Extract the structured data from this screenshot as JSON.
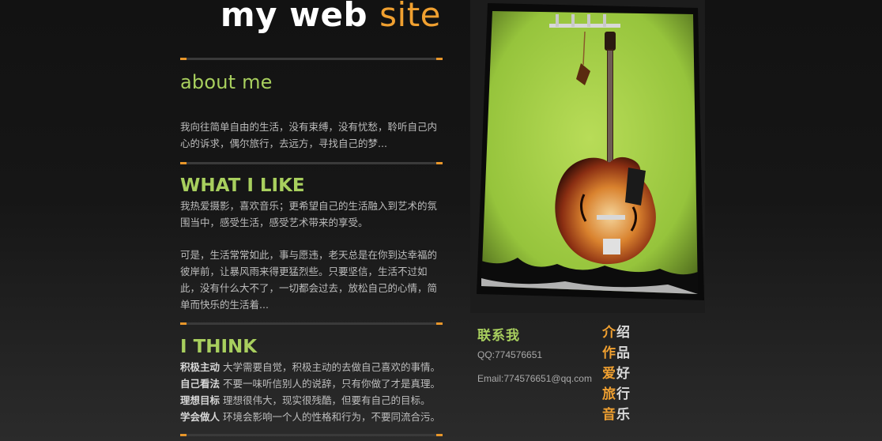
{
  "header": {
    "title_part1": "my web",
    "title_part2": "site"
  },
  "about": {
    "heading": "about me",
    "text": "我向往简单自由的生活，没有束缚，没有忧愁，聆听自己内心的诉求，偶尔旅行，去远方，寻找自己的梦..."
  },
  "like": {
    "heading": "WHAT I LIKE",
    "text1": "我热爱摄影，喜欢音乐；更希望自己的生活融入到艺术的氛围当中，感受生活，感受艺术带来的享受。",
    "text2": "可是，生活常常如此，事与愿违，老天总是在你到达幸福的彼岸前，让暴风雨来得更猛烈些。只要坚信，生活不过如此，没有什么大不了，一切都会过去，放松自己的心情，简单而快乐的生活着..."
  },
  "think": {
    "heading": "I THINK",
    "items": [
      {
        "key": "积极主动",
        "value": "大学需要自觉，积极主动的去做自己喜欢的事情。"
      },
      {
        "key": "自己看法",
        "value": "不要一味听信别人的说辞，只有你做了才是真理。"
      },
      {
        "key": "理想目标",
        "value": "理想很伟大，现实很残酷，但要有自己的目标。"
      },
      {
        "key": "学会做人",
        "value": "环境会影响一个人的性格和行为，不要同流合污。"
      }
    ]
  },
  "contact": {
    "title": "联系我",
    "qq": "QQ:774576651",
    "email": "Email:774576651@qq.com"
  },
  "nav": [
    {
      "accent": "介",
      "rest": "绍"
    },
    {
      "accent": "作",
      "rest": "品"
    },
    {
      "accent": "爱",
      "rest": "好"
    },
    {
      "accent": "旅",
      "rest": "行"
    },
    {
      "accent": "音",
      "rest": "乐"
    }
  ],
  "colors": {
    "accent_orange": "#f0a030",
    "accent_green": "#a8cf5e",
    "wall_green": "#a6d04a",
    "background": "#141414"
  },
  "photo": {
    "subject": "guitar-hanging-on-green-wall"
  }
}
